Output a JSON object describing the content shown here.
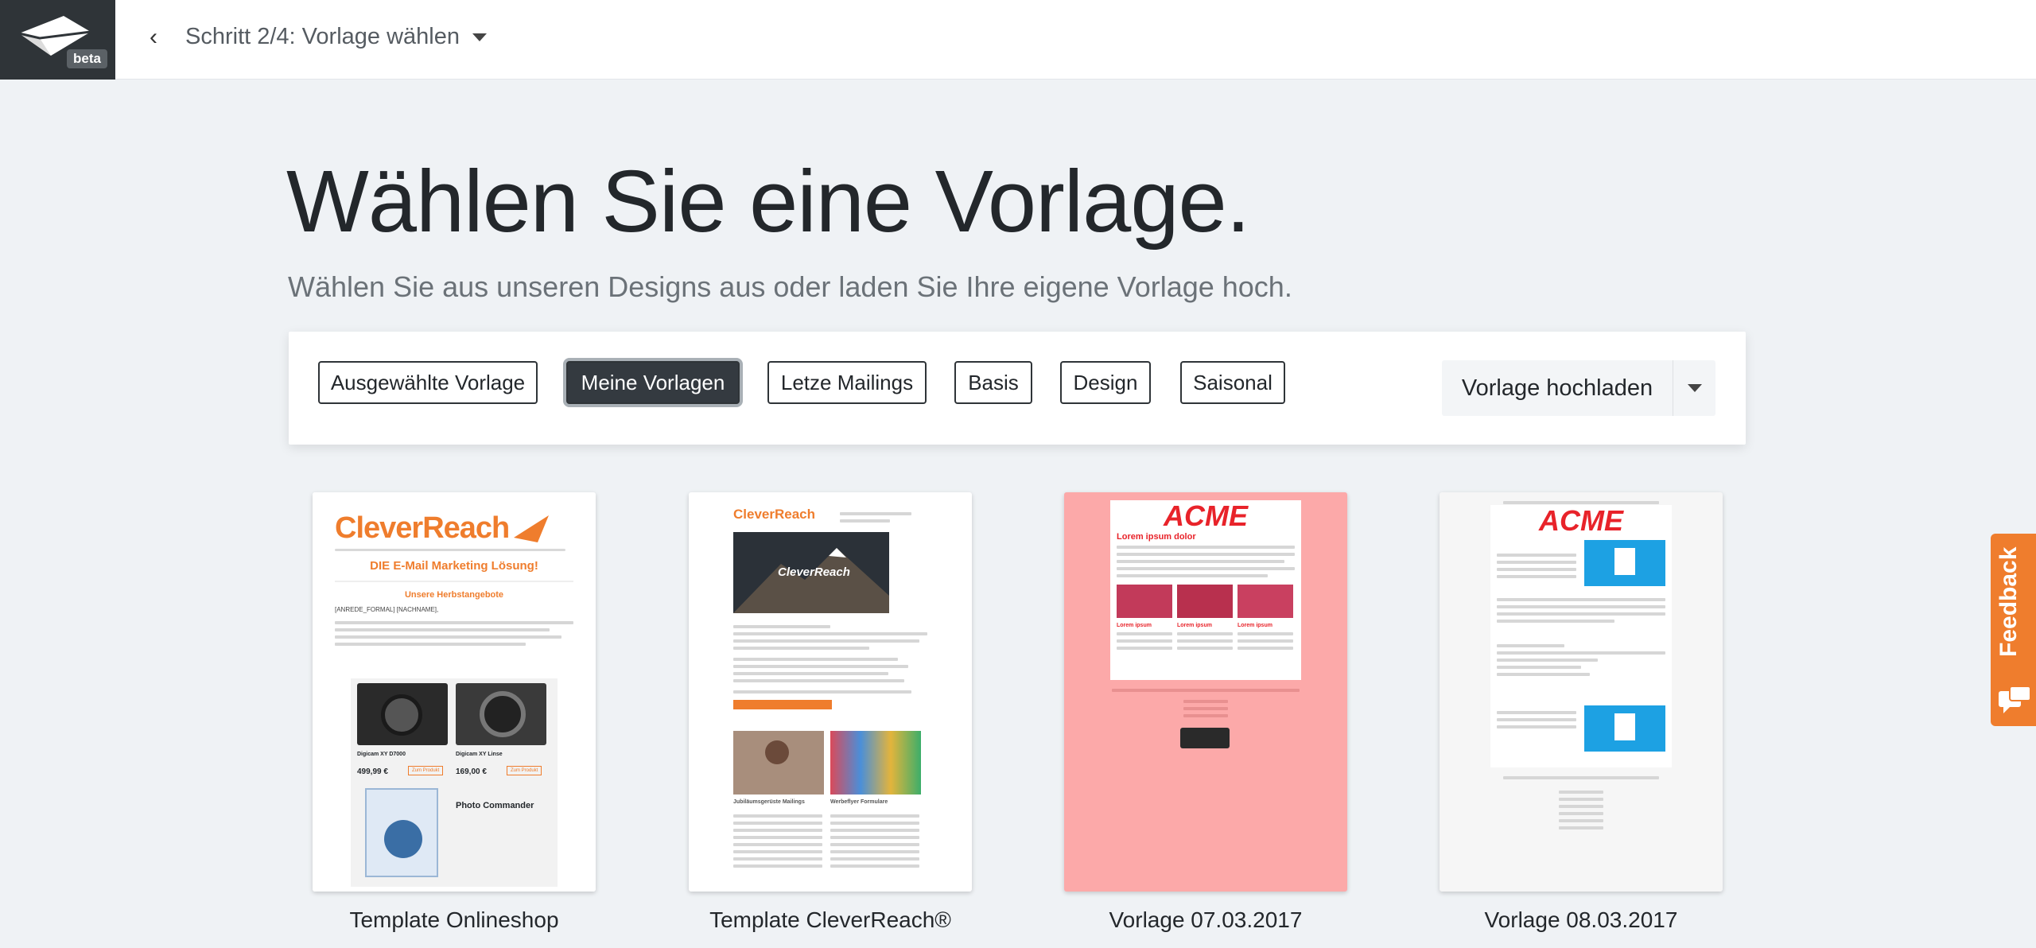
{
  "header": {
    "beta_badge": "beta",
    "back_symbol": "‹",
    "step_label": "Schritt 2/4: Vorlage wählen"
  },
  "hero": {
    "title": "Wählen Sie eine Vorlage.",
    "subtitle": "Wählen Sie aus unseren Designs aus oder laden Sie Ihre eigene Vorlage hoch."
  },
  "filters": {
    "items": [
      {
        "label": "Ausgewählte Vorlage",
        "active": false
      },
      {
        "label": "Meine Vorlagen",
        "active": true
      },
      {
        "label": "Letze Mailings",
        "active": false
      },
      {
        "label": "Basis",
        "active": false
      },
      {
        "label": "Design",
        "active": false
      },
      {
        "label": "Saisonal",
        "active": false
      }
    ],
    "upload_label": "Vorlage hochladen"
  },
  "templates": [
    {
      "title": "Template Onlineshop",
      "brand": "CleverReach",
      "tagline": "DIE E-Mail Marketing Lösung!",
      "heading": "Unsere Herbstangebote",
      "greeting": "[ANREDE_FORMAL] [NACHNAME],",
      "products": [
        {
          "name": "Digicam XY D7000",
          "price": "499,99 €"
        },
        {
          "name": "Digicam XY Linse",
          "price": "169,00 €"
        },
        {
          "name": "Photo Commander",
          "price": ""
        }
      ],
      "button": "Zum Produkt"
    },
    {
      "title": "Template CleverReach®",
      "brand": "CleverReach",
      "banner": "CleverReach",
      "col1": "Jubiläumsgerüste Mailings",
      "col2": "Werbeflyer Formulare"
    },
    {
      "title": "Vorlage 07.03.2017",
      "brand": "ACME",
      "heading": "Lorem ipsum dolor",
      "col_heading": "Lorem ipsum"
    },
    {
      "title": "Vorlage 08.03.2017",
      "brand": "ACME"
    }
  ],
  "feedback": {
    "label": "Feedback"
  },
  "colors": {
    "accent_orange": "#ef7d2d",
    "acme_red": "#e8232a",
    "pink_bg": "#fca9a9",
    "dark": "#343a40"
  }
}
